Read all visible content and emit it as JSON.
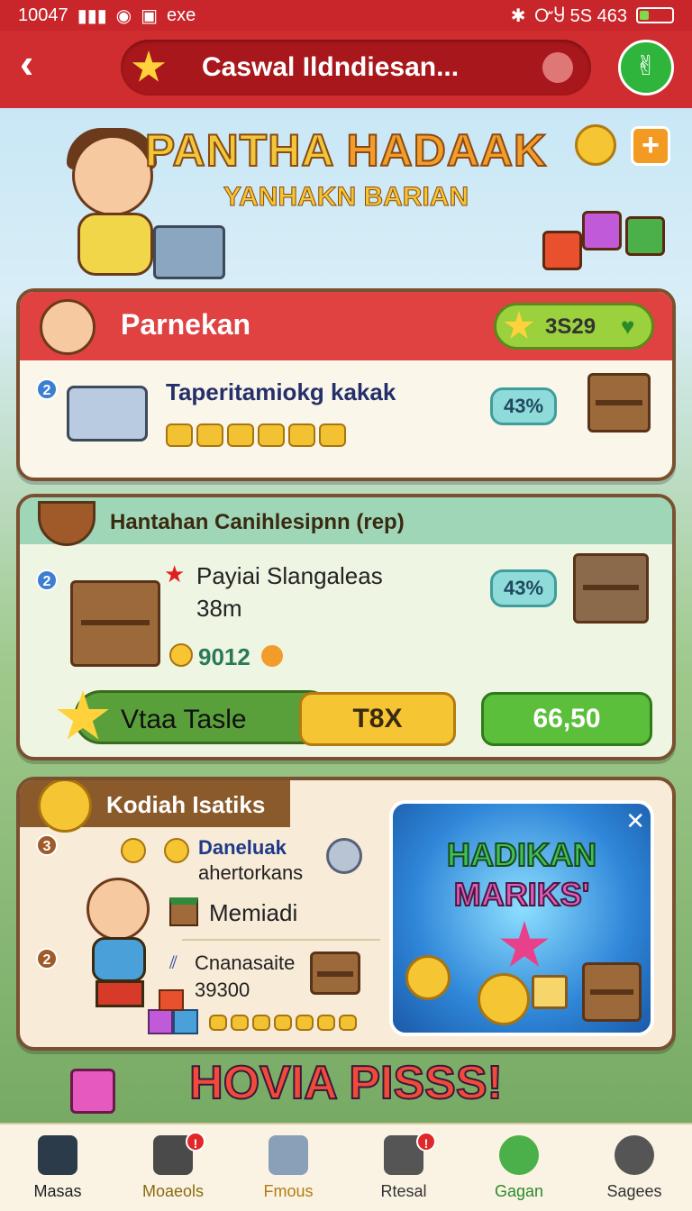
{
  "status_bar": {
    "time": "10047",
    "app_label": "exe",
    "right_text": "ᏅႸ 5S 463",
    "battery_level": 0.3
  },
  "app_bar": {
    "title": "Caswal Ildndiesan..."
  },
  "hero": {
    "title_part1": "PANTHA",
    "title_part2": "HADAAK",
    "subtitle": "YANHAKN BARIAN"
  },
  "panel1": {
    "header": "Parnekan",
    "balance": "3S29",
    "badge": "2",
    "item_title": "Taperitamiokg kakak",
    "percent": "43%"
  },
  "panel2": {
    "header": "Hantahan Canihlesipnn (rep)",
    "badge": "2",
    "item_title_line1": "Payiai Slangaleas",
    "item_title_line2": "38m",
    "coins": "9012",
    "percent": "43%",
    "action_label": "Vtaa Tasle",
    "action_value": "T8X",
    "action_price": "66,50"
  },
  "panel3": {
    "header": "Kodiah Isatiks",
    "badge_top": "3",
    "badge_bottom": "2",
    "row1_title": "Daneluak",
    "row1_sub": "ahertorkans",
    "row2_title": "Memiadi",
    "row3_title": "Cnanasaite",
    "row3_value": "39300",
    "promo_line1": "HADIKAN",
    "promo_line2": "MARIKS'"
  },
  "footer_banner": "HOVIA PISSS!",
  "bottom_nav": [
    {
      "label": "Masas",
      "icon": "home-icon",
      "color": "#222222"
    },
    {
      "label": "Moaeols",
      "icon": "phone-icon",
      "color": "#8a6a10",
      "badge": "!"
    },
    {
      "label": "Fmous",
      "icon": "door-icon",
      "color": "#b37b10"
    },
    {
      "label": "Rtesal",
      "icon": "reader-icon",
      "color": "#333333",
      "badge": "!"
    },
    {
      "label": "Gagan",
      "icon": "face-icon",
      "color": "#2a8a2a"
    },
    {
      "label": "Sagees",
      "icon": "gear-icon",
      "color": "#333333"
    }
  ]
}
